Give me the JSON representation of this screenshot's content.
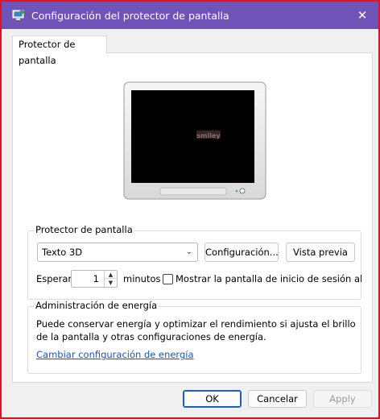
{
  "window": {
    "title": "Configuración del protector de pantalla",
    "close_glyph": "✕",
    "accent_color": "#6f53b6",
    "border_color": "#d6152b",
    "icon": "display-settings-icon"
  },
  "tab": {
    "label": "Protector de pantalla"
  },
  "preview": {
    "screen_text": "smiley",
    "monitor_icon": "monitor-icon"
  },
  "screensaver": {
    "group_title": "Protector de pantalla",
    "selected": "Texto 3D",
    "settings_button": "Configuración...",
    "preview_button": "Vista previa",
    "wait_label": "Esperar:",
    "wait_value": "1",
    "minutes_label": "minutos",
    "logon_checkbox_label": "Mostrar la pantalla de inicio de sesión al re",
    "logon_checked": false
  },
  "power": {
    "group_title": "Administración de energía",
    "description": "Puede conservar energía y optimizar el rendimiento si ajusta el brillo de la pantalla y otras configuraciones de energía.",
    "link": "Cambiar configuración de energía",
    "link_color": "#1a56b8"
  },
  "footer": {
    "ok": "OK",
    "cancel": "Cancelar",
    "apply": "Apply"
  }
}
